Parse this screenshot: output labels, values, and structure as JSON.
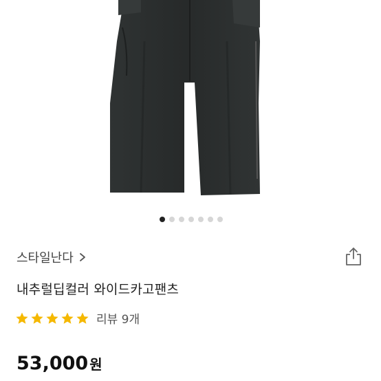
{
  "product": {
    "store_name": "스타일난다",
    "title": "내추럴딥컬러 와이드카고팬츠",
    "rating_stars": 5,
    "review_label": "리뷰 9개",
    "price": "53,000",
    "currency": "원"
  },
  "gallery": {
    "image_count": 7,
    "active_index": 0
  },
  "colors": {
    "star": "#f5b800",
    "dot_active": "#222222",
    "dot_inactive": "#d6d6d6",
    "pants": "#2b2e2e"
  },
  "icons": {
    "store_link": "chevron-right-icon",
    "share": "share-icon",
    "rating": "star-icon"
  }
}
